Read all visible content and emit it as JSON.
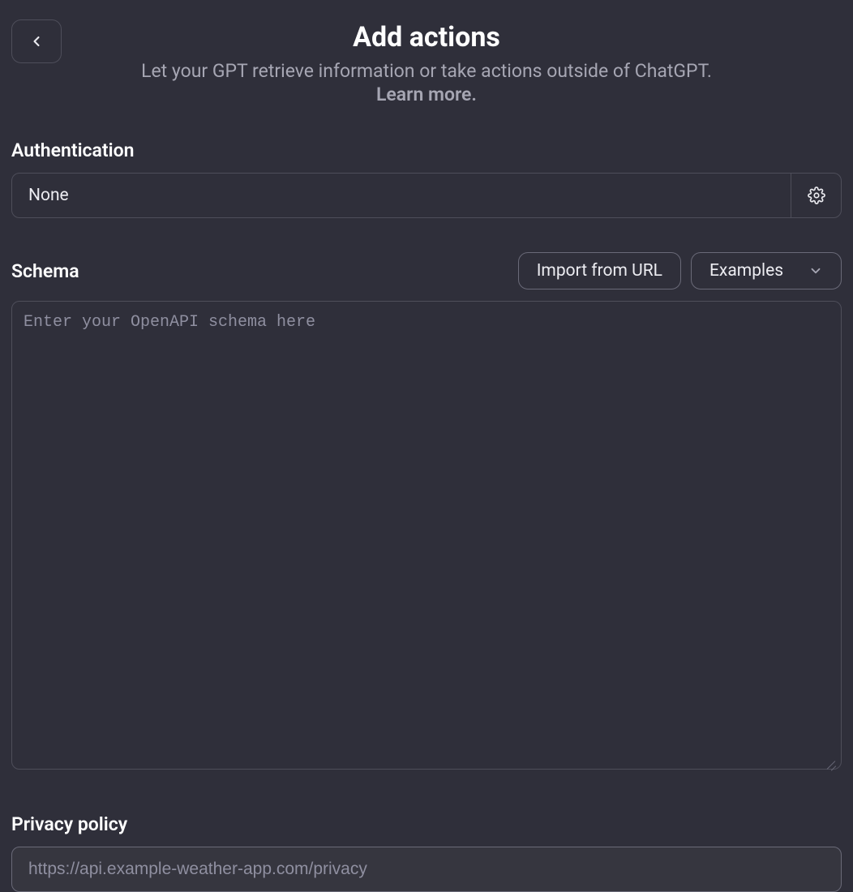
{
  "header": {
    "title": "Add actions",
    "subtitle": "Let your GPT retrieve information or take actions outside of ChatGPT.",
    "learn_more": "Learn more."
  },
  "authentication": {
    "label": "Authentication",
    "value": "None"
  },
  "schema": {
    "label": "Schema",
    "import_btn": "Import from URL",
    "examples_btn": "Examples",
    "placeholder": "Enter your OpenAPI schema here",
    "value": ""
  },
  "privacy": {
    "label": "Privacy policy",
    "placeholder": "https://api.example-weather-app.com/privacy",
    "value": ""
  }
}
